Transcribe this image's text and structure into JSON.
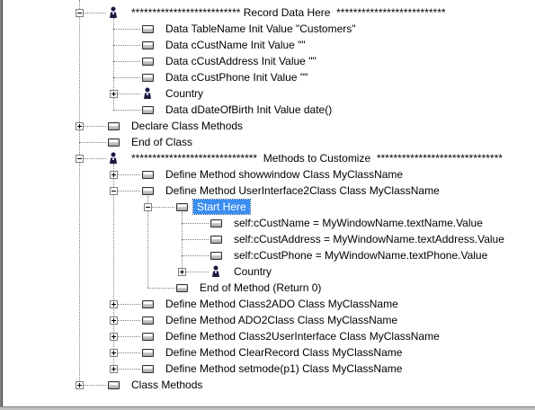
{
  "tree": {
    "record_header": "************************** Record Data Here  **************************",
    "data_tablename": "Data TableName Init Value \"Customers\"",
    "data_custname": "Data cCustName Init Value \"\"",
    "data_custaddress": "Data cCustAddress Init Value \"\"",
    "data_custphone": "Data cCustPhone Init Value \"\"",
    "country_1": "Country",
    "data_dateofbirth": "Data dDateOfBirth Init Value date()",
    "declare_class_methods": "Declare Class Methods",
    "end_of_class": "End of Class",
    "methods_header": "******************************  Methods to Customize  ******************************",
    "define_showwindow": "Define Method showwindow Class MyClassName",
    "define_userinterface2class": "Define Method UserInterface2Class Class MyClassName",
    "start_here": "Start Here",
    "self_custname": "self:cCustName = MyWindowName.textName.Value",
    "self_custaddress": "self:cCustAddress = MyWindowName.textAddress.Value",
    "self_custphone": "self:cCustPhone = MyWindowName.textPhone.Value",
    "country_2": "Country",
    "end_of_method": "End of Method (Return 0)",
    "define_class2ado": "Define Method Class2ADO Class MyClassName",
    "define_ado2class": "Define Method ADO2Class Class MyClassName",
    "define_class2userinterface": "Define Method Class2UserInterface Class MyClassName",
    "define_clearrecord": "Define Method ClearRecord Class MyClassName",
    "define_setmode": "Define Method setmode(p1) Class MyClassName",
    "class_methods": "Class Methods"
  },
  "colors": {
    "selection": "#3b8ef0",
    "tree_lines": "#808080"
  },
  "icons": {
    "collapse": "minus-box-icon",
    "expand": "plus-box-icon",
    "node": "code-node-icon",
    "person": "person-icon"
  }
}
